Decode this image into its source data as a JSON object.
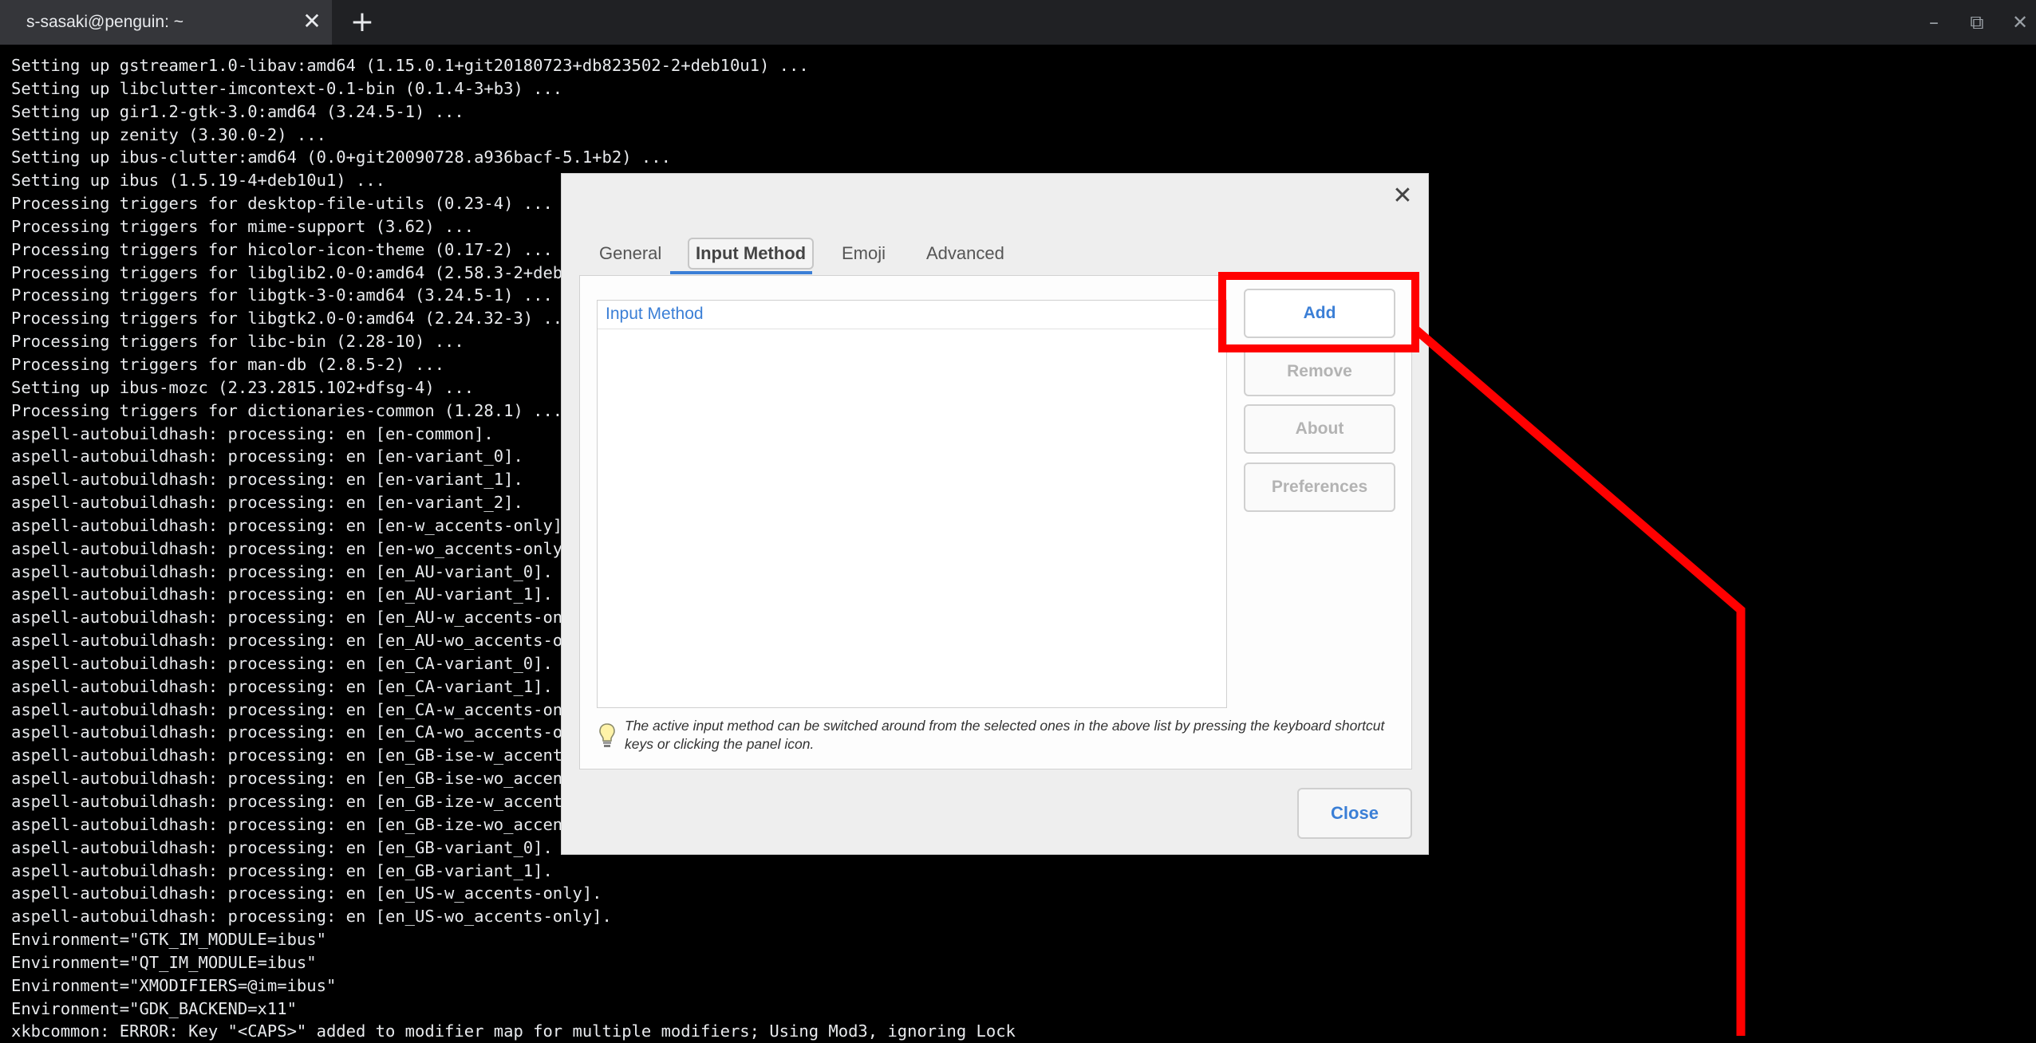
{
  "window": {
    "tab_title": "s-sasaki@penguin: ~",
    "tab_close_glyph": "✕",
    "new_tab_glyph": "+",
    "controls": {
      "minimize": "–",
      "restore": "⧉",
      "close": "✕"
    }
  },
  "terminal": {
    "lines": [
      "Setting up gstreamer1.0-libav:amd64 (1.15.0.1+git20180723+db823502-2+deb10u1) ...",
      "Setting up libclutter-imcontext-0.1-bin (0.1.4-3+b3) ...",
      "Setting up gir1.2-gtk-3.0:amd64 (3.24.5-1) ...",
      "Setting up zenity (3.30.0-2) ...",
      "Setting up ibus-clutter:amd64 (0.0+git20090728.a936bacf-5.1+b2) ...",
      "Setting up ibus (1.5.19-4+deb10u1) ...",
      "Processing triggers for desktop-file-utils (0.23-4) ...",
      "Processing triggers for mime-support (3.62) ...",
      "Processing triggers for hicolor-icon-theme (0.17-2) ...",
      "Processing triggers for libglib2.0-0:amd64 (2.58.3-2+deb10u2) ...",
      "Processing triggers for libgtk-3-0:amd64 (3.24.5-1) ...",
      "Processing triggers for libgtk2.0-0:amd64 (2.24.32-3) ...",
      "Processing triggers for libc-bin (2.28-10) ...",
      "Processing triggers for man-db (2.8.5-2) ...",
      "Setting up ibus-mozc (2.23.2815.102+dfsg-4) ...",
      "Processing triggers for dictionaries-common (1.28.1) ...",
      "aspell-autobuildhash: processing: en [en-common].",
      "aspell-autobuildhash: processing: en [en-variant_0].",
      "aspell-autobuildhash: processing: en [en-variant_1].",
      "aspell-autobuildhash: processing: en [en-variant_2].",
      "aspell-autobuildhash: processing: en [en-w_accents-only].",
      "aspell-autobuildhash: processing: en [en-wo_accents-only].",
      "aspell-autobuildhash: processing: en [en_AU-variant_0].",
      "aspell-autobuildhash: processing: en [en_AU-variant_1].",
      "aspell-autobuildhash: processing: en [en_AU-w_accents-only].",
      "aspell-autobuildhash: processing: en [en_AU-wo_accents-only].",
      "aspell-autobuildhash: processing: en [en_CA-variant_0].",
      "aspell-autobuildhash: processing: en [en_CA-variant_1].",
      "aspell-autobuildhash: processing: en [en_CA-w_accents-only].",
      "aspell-autobuildhash: processing: en [en_CA-wo_accents-only].",
      "aspell-autobuildhash: processing: en [en_GB-ise-w_accents-only].",
      "aspell-autobuildhash: processing: en [en_GB-ise-wo_accents-only].",
      "aspell-autobuildhash: processing: en [en_GB-ize-w_accents-only].",
      "aspell-autobuildhash: processing: en [en_GB-ize-wo_accents-only].",
      "aspell-autobuildhash: processing: en [en_GB-variant_0].",
      "aspell-autobuildhash: processing: en [en_GB-variant_1].",
      "aspell-autobuildhash: processing: en [en_US-w_accents-only].",
      "aspell-autobuildhash: processing: en [en_US-wo_accents-only].",
      "Environment=\"GTK_IM_MODULE=ibus\"",
      "Environment=\"QT_IM_MODULE=ibus\"",
      "Environment=\"XMODIFIERS=@im=ibus\"",
      "Environment=\"GDK_BACKEND=x11\"",
      "xkbcommon: ERROR: Key \"<CAPS>\" added to modifier map for multiple modifiers; Using Mod3, ignoring Lock"
    ]
  },
  "dialog": {
    "close_glyph": "✕",
    "tabs": [
      {
        "label": "General",
        "active": false
      },
      {
        "label": "Input Method",
        "active": true
      },
      {
        "label": "Emoji",
        "active": false
      },
      {
        "label": "Advanced",
        "active": false
      }
    ],
    "list_header": "Input Method",
    "buttons": {
      "add": "Add",
      "remove": "Remove",
      "about": "About",
      "preferences": "Preferences"
    },
    "hint": "The active input method can be switched around from the selected ones in the above list by pressing the keyboard shortcut keys or clicking the panel icon.",
    "close_button": "Close"
  },
  "colors": {
    "accent": "#3b7fd6",
    "annotation": "#ff0000",
    "terminal_bg": "#000000",
    "terminal_fg": "#e8eaed"
  }
}
